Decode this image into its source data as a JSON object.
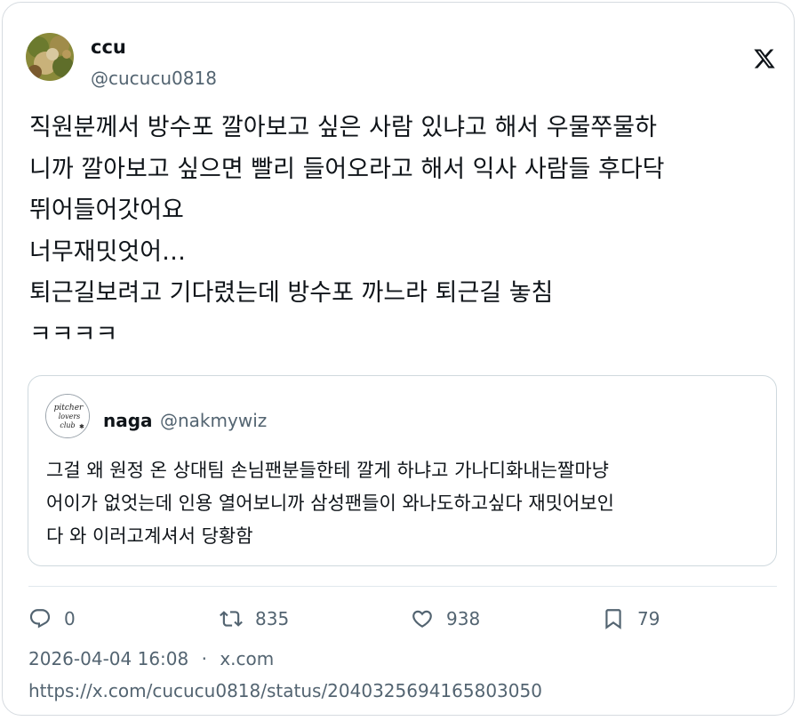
{
  "author": {
    "name": "ccu",
    "handle": "@cucucu0818"
  },
  "tweet_lines": [
    "직원분께서 방수포 깔아보고 싶은 사람 있냐고 해서 우물쭈물하",
    "니까 깔아보고 싶으면 빨리 들어오라고 해서 익사 사람들 후다닥",
    "뛰어들어갓어요",
    "너무재밋엇어…",
    "퇴근길보려고 기다렸는데 방수포 까느라 퇴근길 놓침",
    "ㅋㅋㅋㅋ"
  ],
  "quote": {
    "name": "naga",
    "handle": "@nakmywiz",
    "avatar_text": [
      "pitcher",
      "lovers",
      "club"
    ],
    "lines": [
      "그걸 왜 원정 온 상대팀 손님팬분들한테 깔게 하냐고 가나디화내는짤마냥",
      "어이가 없엇는데 인용 열어보니까 삼성팬들이 와나도하고싶다 재밋어보인",
      "다 와 이러고계셔서 당황함"
    ]
  },
  "actions": {
    "reply": "0",
    "retweet": "835",
    "like": "938",
    "bookmark": "79"
  },
  "meta": {
    "timestamp": "2026-04-04 16:08",
    "separator": "·",
    "source": "x.com",
    "url": "https://x.com/cucucu0818/status/2040325694165803050"
  },
  "icons": {
    "logo": "x-logo-icon",
    "reply": "reply-icon",
    "retweet": "retweet-icon",
    "like": "heart-icon",
    "bookmark": "bookmark-icon"
  },
  "colors": {
    "text": "#0f1419",
    "secondary": "#536471",
    "border": "#cfd9de"
  }
}
